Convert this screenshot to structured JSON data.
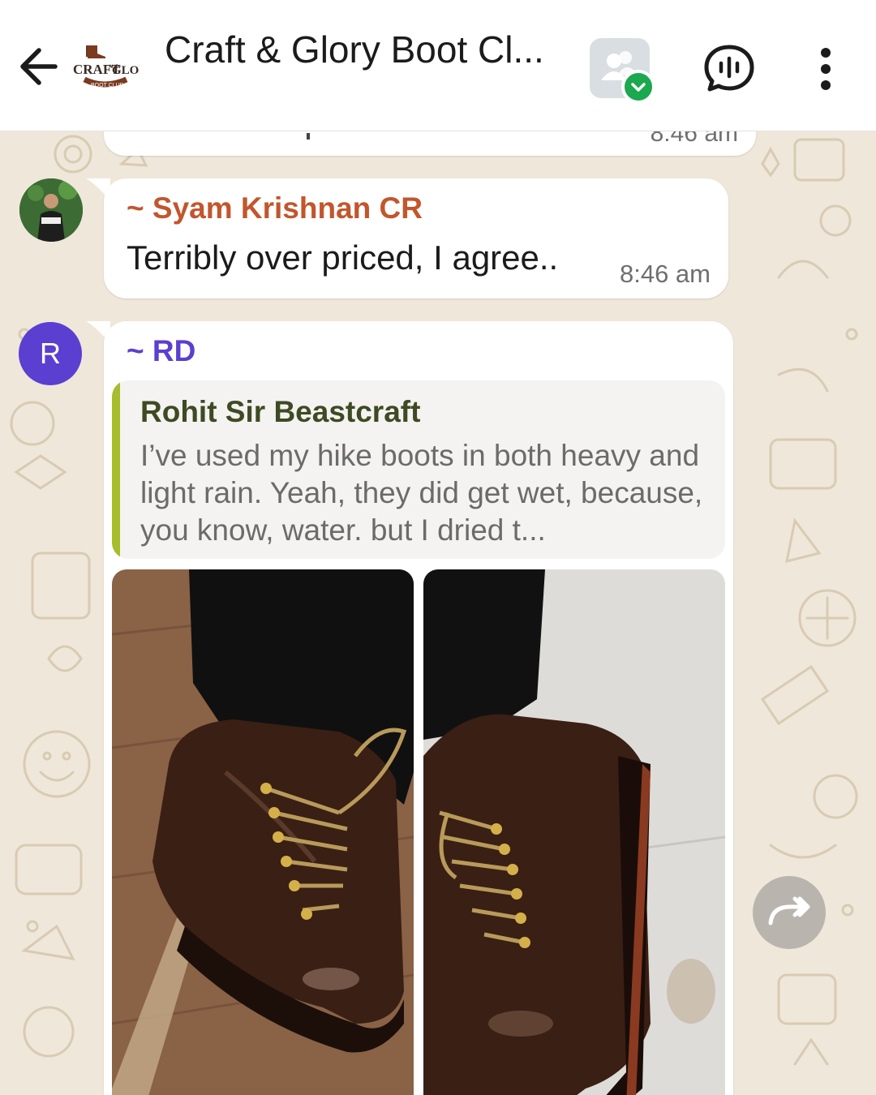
{
  "header": {
    "title": "Craft & Glory Boot Cl...",
    "logo_text_top": "CRAFT",
    "logo_text_and": "AND",
    "logo_text_glory": "GLORY",
    "logo_text_bottom": "BOOT CLUB"
  },
  "icons": {
    "back": "arrow-left-icon",
    "community": "people-icon",
    "community_badge": "checkmark-chevron-icon",
    "voice_chat": "voice-chat-icon",
    "menu": "more-vertical-icon",
    "forward": "forward-icon"
  },
  "messages": {
    "previous": {
      "time": "8:46 am"
    },
    "syam": {
      "sender": "~ Syam Krishnan CR",
      "text": "Terribly over priced, I agree..",
      "time": "8:46 am"
    },
    "rd": {
      "avatar_letter": "R",
      "sender": "~ RD",
      "quote": {
        "author": "Rohit Sir Beastcraft",
        "text": "I’ve used my hike boots in both heavy and light rain. Yeah, they did get wet, because, you know, water. but I dried t..."
      }
    }
  },
  "colors": {
    "chat_bg": "#efe7da",
    "sender_syam": "#c2562c",
    "sender_rd": "#5b3fd0",
    "quote_bar": "#a7bd2c",
    "badge_green": "#1ba84f"
  }
}
